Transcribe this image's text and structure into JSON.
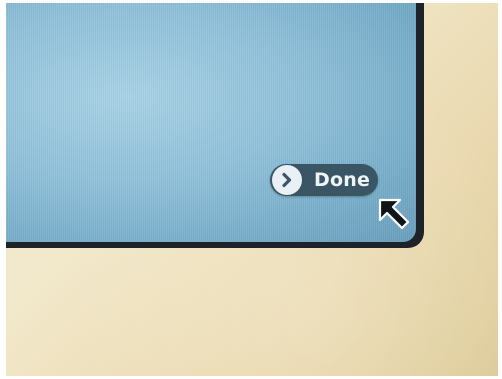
{
  "screen": {
    "done_button": {
      "label": "Done",
      "icon": "chevron-right-icon"
    },
    "resize_handle": {
      "icon": "arrow-up-left-icon"
    }
  },
  "colors": {
    "screen": "#8fc0d9",
    "bezel": "#1d2328",
    "button": "#3a5665",
    "device_body": "#efe5c6"
  }
}
